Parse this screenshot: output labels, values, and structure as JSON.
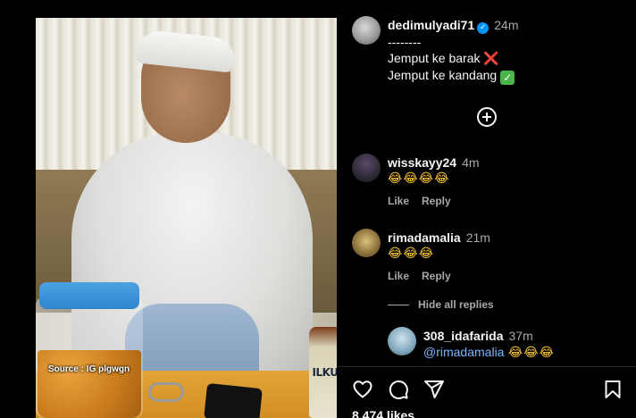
{
  "video": {
    "watermark": "Source : IG plgwgn",
    "bottle_label": "ILKU"
  },
  "caption": {
    "username": "dedimulyadi71",
    "verified_icon": "check",
    "time": "24m",
    "line1": "--------",
    "line2": "Jemput ke barak",
    "line2_emoji": "❌",
    "line3": "Jemput ke kandang",
    "line3_emoji": "✓"
  },
  "comments": [
    {
      "username": "wisskayy24",
      "time": "4m",
      "text": "😂😂😂😂",
      "like": "Like",
      "reply": "Reply"
    },
    {
      "username": "rimadamalia",
      "time": "21m",
      "text": "😂😂😂",
      "like": "Like",
      "reply": "Reply"
    }
  ],
  "hide_replies": "Hide all replies",
  "reply": {
    "username": "308_idafarida",
    "time": "37m",
    "mention": "@rimadamalia",
    "text": "😂😂😂"
  },
  "likes": "8,474 likes",
  "colors": {
    "background": "#000000",
    "text": "#f5f5f5",
    "muted": "#a8a8a8",
    "verified": "#0095f6",
    "mention": "#7ab6ff"
  },
  "icons": [
    "heart-icon",
    "comment-icon",
    "share-icon",
    "bookmark-icon",
    "add-circle-icon"
  ]
}
